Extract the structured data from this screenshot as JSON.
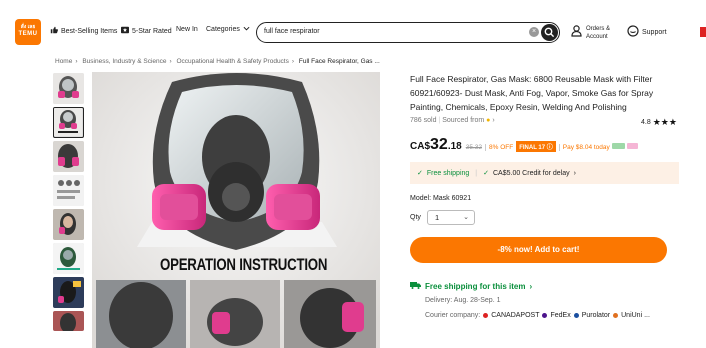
{
  "header": {
    "logo_line1": "สั่ง เลย",
    "logo_line2": "TEMU",
    "nav": [
      "Best-Selling Items",
      "5-Star Rated",
      "New In",
      "Categories"
    ],
    "search_value": "full face respirator",
    "orders_label_1": "Orders &",
    "orders_label_2": "Account",
    "support_label": "Support"
  },
  "breadcrumb": [
    "Home",
    "Business, Industry & Science",
    "Occupational Health & Safety Products",
    "Full Face Respirator, Gas ..."
  ],
  "gallery": {
    "thumbnail_count": 8,
    "active_index": 1,
    "overlay_text": "OPERATION INSTRUCTION"
  },
  "product": {
    "title": "Full Face Respirator, Gas Mask: 6800 Reusable Mask with Filter 60921/60923- Dust Mask, Anti Fog, Vapor, Smoke Gas for Spray Painting, Chemicals, Epoxy Resin, Welding And Polishing",
    "sold": "786 sold",
    "sourced_from": "Sourced from",
    "rating": "4.8",
    "stars": "★★★",
    "price_currency": "CA$",
    "price_main": "32",
    "price_decimal": ".18",
    "price_old": "35.32",
    "pct_off": "8% OFF",
    "final_badge": "FINAL 17",
    "pay_today": "Pay $8.04 today",
    "free_shipping_inline": "Free shipping",
    "credit_delay": "CA$5.00 Credit for delay",
    "model_label": "Model: Mask 60921",
    "qty_label": "Qty",
    "qty_value": "1",
    "cart_button": "-8% now! Add to cart!",
    "free_shipping_title": "Free shipping for this item",
    "delivery": "Delivery: Aug. 28-Sep. 1",
    "courier_label": "Courier company:",
    "couriers": [
      "CANADAPOST",
      "FedEx",
      "Purolator",
      "UniUni ..."
    ]
  },
  "colors": {
    "accent": "#fb7701",
    "success": "#0a8f3c"
  }
}
